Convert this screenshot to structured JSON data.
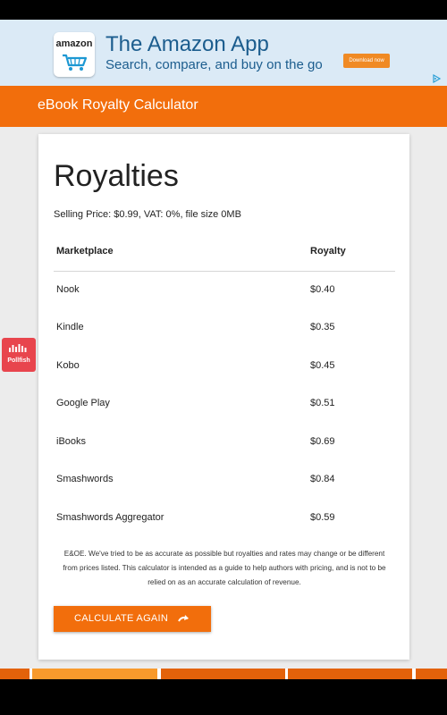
{
  "ad": {
    "logo_text": "amazon",
    "title": "The Amazon App",
    "subtitle": "Search, compare, and buy on the go",
    "button_label": "Download now"
  },
  "app_bar": {
    "title": "eBook Royalty Calculator"
  },
  "results": {
    "heading": "Royalties",
    "summary": "Selling Price: $0.99, VAT: 0%, file size 0MB",
    "columns": {
      "marketplace": "Marketplace",
      "royalty": "Royalty"
    },
    "rows": [
      {
        "marketplace": "Nook",
        "royalty": "$0.40"
      },
      {
        "marketplace": "Kindle",
        "royalty": "$0.35"
      },
      {
        "marketplace": "Kobo",
        "royalty": "$0.45"
      },
      {
        "marketplace": "Google Play",
        "royalty": "$0.51"
      },
      {
        "marketplace": "iBooks",
        "royalty": "$0.69"
      },
      {
        "marketplace": "Smashwords",
        "royalty": "$0.84"
      },
      {
        "marketplace": "Smashwords Aggregator",
        "royalty": "$0.59"
      }
    ],
    "disclaimer": "E&OE. We've tried to be as accurate as possible but royalties and rates may change or be different from prices listed. This calculator is intended as a guide to help authors with pricing, and is not to be relied on as an accurate calculation of revenue.",
    "button_label": "CALCULATE AGAIN",
    "button_icon": "redo-arrow-icon"
  },
  "pollfish": {
    "label": "Pollfish"
  },
  "colors": {
    "accent": "#f26e0c",
    "ad_background": "#dbeaf6",
    "ad_text": "#1c5d8e",
    "pollfish": "#e8454d"
  }
}
